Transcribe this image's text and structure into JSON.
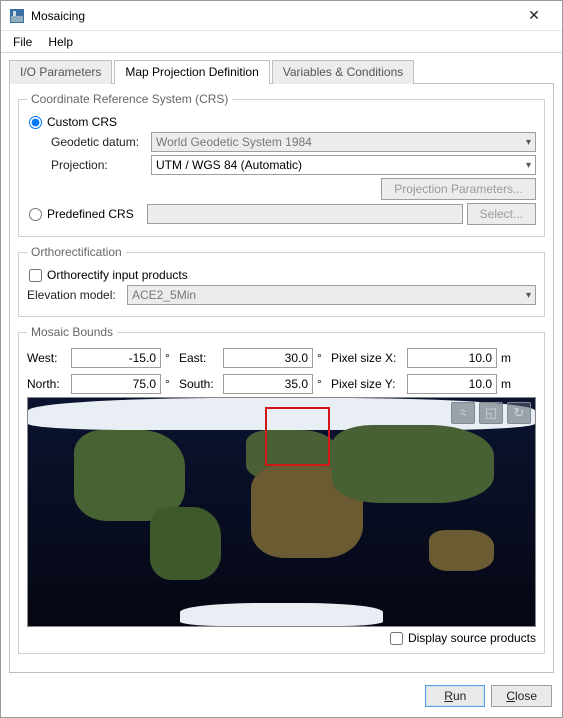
{
  "window": {
    "title": "Mosaicing"
  },
  "menubar": {
    "file": "File",
    "help": "Help"
  },
  "tabs": {
    "io": "I/O Parameters",
    "map": "Map Projection Definition",
    "vars": "Variables & Conditions",
    "active": "map"
  },
  "crs": {
    "legend": "Coordinate Reference System (CRS)",
    "custom_label": "Custom CRS",
    "predefined_label": "Predefined CRS",
    "geodetic_label": "Geodetic datum:",
    "projection_label": "Projection:",
    "geodetic_value": "World Geodetic System 1984",
    "projection_value": "UTM / WGS 84 (Automatic)",
    "proj_params_btn": "Projection Parameters...",
    "select_btn": "Select..."
  },
  "ortho": {
    "legend": "Orthorectification",
    "check_label": "Orthorectify input products",
    "elev_label": "Elevation model:",
    "elev_value": "ACE2_5Min"
  },
  "bounds": {
    "legend": "Mosaic Bounds",
    "west_label": "West:",
    "west_value": "-15.0",
    "east_label": "East:",
    "east_value": "30.0",
    "north_label": "North:",
    "north_value": "75.0",
    "south_label": "South:",
    "south_value": "35.0",
    "deg": "°",
    "px_x_label": "Pixel size X:",
    "px_x_value": "10.0",
    "px_y_label": "Pixel size Y:",
    "px_y_value": "10.0",
    "m": "m",
    "display_src_label": "Display source products"
  },
  "map": {
    "roi": {
      "left_pct": 46.7,
      "top_pct": 4,
      "width_pct": 12.9,
      "height_pct": 26
    }
  },
  "footer": {
    "run": "Run",
    "close": "Close"
  }
}
